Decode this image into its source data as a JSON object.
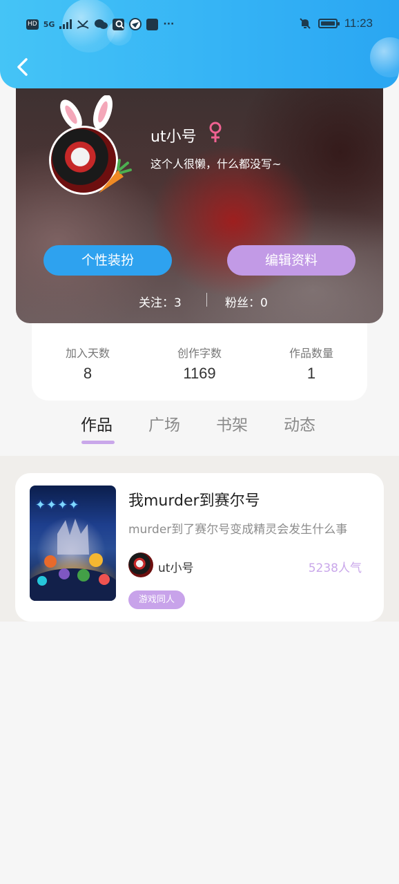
{
  "status_bar": {
    "chips": [
      "HD",
      "5G"
    ],
    "time": "11:23",
    "battery_level": 0.85
  },
  "profile": {
    "username": "ut小号",
    "gender": "female",
    "bio": "这个人很懒，什么都没写~",
    "dress_button": "个性装扮",
    "edit_button": "编辑资料",
    "follow_label": "关注：3",
    "fans_label": "粉丝：0"
  },
  "stats": [
    {
      "label": "加入天数",
      "value": "8"
    },
    {
      "label": "创作字数",
      "value": "1169"
    },
    {
      "label": "作品数量",
      "value": "1"
    }
  ],
  "tabs": [
    "作品",
    "广场",
    "书架",
    "动态"
  ],
  "active_tab": 0,
  "work": {
    "title": "我murder到赛尔号",
    "description": "murder到了赛尔号变成精灵会发生什么事",
    "author": "ut小号",
    "popularity": "5238人气",
    "tag": "游戏同人"
  },
  "colors": {
    "header": "#34b2f5",
    "dress_button": "#2ea2ef",
    "edit_button": "#c29ae6",
    "accent": "#c9a7ea",
    "gender_icon": "#f06292"
  }
}
